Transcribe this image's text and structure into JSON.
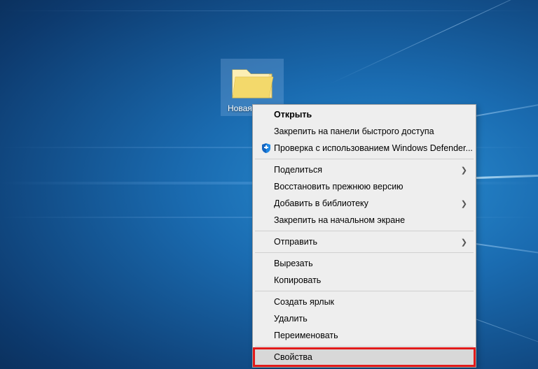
{
  "desktop": {
    "folder_label": "Новая папка"
  },
  "context_menu": {
    "open": "Открыть",
    "pin_quick_access": "Закрепить на панели быстрого доступа",
    "defender_scan": "Проверка с использованием Windows Defender...",
    "share": "Поделиться",
    "restore_previous": "Восстановить прежнюю версию",
    "add_to_library": "Добавить в библиотеку",
    "pin_start": "Закрепить на начальном экране",
    "send_to": "Отправить",
    "cut": "Вырезать",
    "copy": "Копировать",
    "create_shortcut": "Создать ярлык",
    "delete": "Удалить",
    "rename": "Переименовать",
    "properties": "Свойства"
  }
}
